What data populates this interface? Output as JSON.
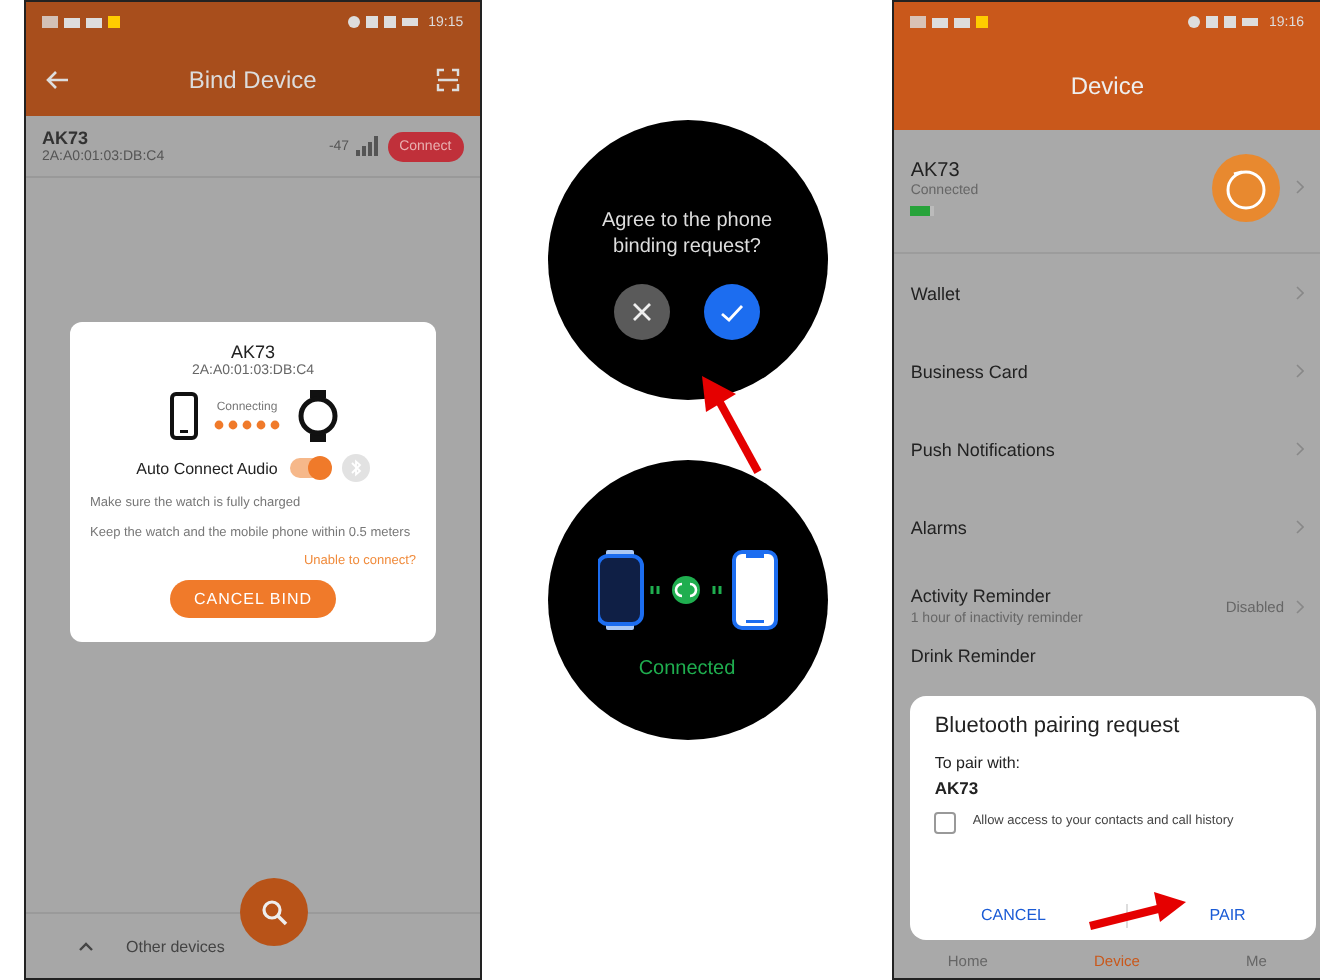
{
  "bind_screen": {
    "status_time": "19:15",
    "title": "Bind Device",
    "device": {
      "name": "AK73",
      "mac": "2A:A0:01:03:DB:C4",
      "rssi": "-47",
      "button": "Connect"
    },
    "dialog": {
      "name": "AK73",
      "mac": "2A:A0:01:03:DB:C4",
      "status": "Connecting",
      "audio_label": "Auto Connect Audio",
      "audio_on": true,
      "tips": [
        "Make sure the watch is fully charged",
        "Keep the watch and the mobile phone within 0.5 meters"
      ],
      "help_link": "Unable to connect?",
      "cancel_button": "CANCEL BIND"
    },
    "other_devices": "Other devices"
  },
  "watch_request": {
    "question": "Agree to the phone binding request?"
  },
  "watch_connected": {
    "status": "Connected"
  },
  "device_screen": {
    "status_time": "19:16",
    "title": "Device",
    "device": {
      "name": "AK73",
      "status": "Connected",
      "battery": {
        "level": 0.8
      }
    },
    "rows": [
      {
        "label": "Wallet"
      },
      {
        "label": "Business Card"
      },
      {
        "label": "Push Notifications"
      },
      {
        "label": "Alarms"
      },
      {
        "label": "Activity Reminder",
        "subtitle": "1 hour of inactivity reminder",
        "value": "Disabled"
      },
      {
        "label": "Drink Reminder"
      }
    ],
    "pairing_dialog": {
      "title": "Bluetooth pairing request",
      "pair_with_label": "To pair with:",
      "device": "AK73",
      "allow_access": "Allow access to your contacts and call history",
      "allow_checked": false,
      "cancel": "CANCEL",
      "pair": "PAIR"
    },
    "nav": [
      {
        "label": "Home",
        "selected": false
      },
      {
        "label": "Device",
        "selected": true
      },
      {
        "label": "Me",
        "selected": false
      }
    ]
  }
}
